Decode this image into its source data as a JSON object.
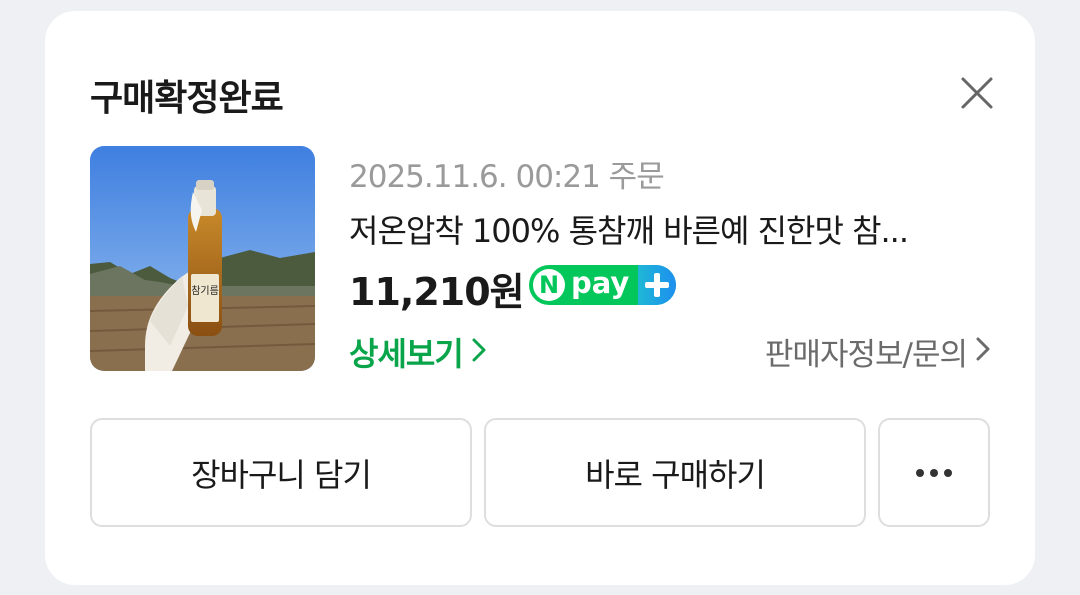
{
  "dialog": {
    "title": "구매확정완료",
    "close_icon": "close-icon"
  },
  "product": {
    "order_info": "2025.11.6. 00:21 주문",
    "name": "저온압착 100% 통참깨 바른예 진한맛 참...",
    "price": "11,210원",
    "badge": {
      "n_letter": "N",
      "pay_text": "pay",
      "icon": "npay-plus-icon",
      "brand_color": "#03c75a",
      "plus_gradient": [
        "#1fb7d6",
        "#1e8ff0"
      ]
    },
    "image": {
      "icon": "product-thumbnail",
      "bottle_label_line": "참기름"
    }
  },
  "links": {
    "detail": "상세보기",
    "seller": "판매자정보/문의",
    "detail_color": "#0aa54a"
  },
  "buttons": {
    "cart": "장바구니 담기",
    "buy": "바로 구매하기",
    "more_icon": "more-icon"
  }
}
